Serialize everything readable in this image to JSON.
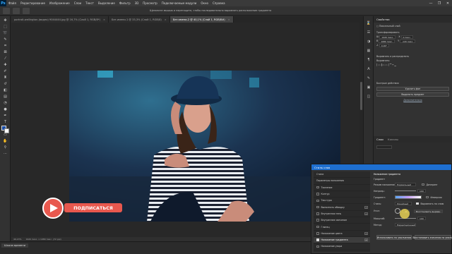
{
  "app": {
    "logo": "Ps"
  },
  "menu": [
    "Файл",
    "Редактирование",
    "Изображение",
    "Слои",
    "Текст",
    "Выделение",
    "Фильтр",
    "3D",
    "Просмотр",
    "Подключаемые модули",
    "Окно",
    "Справка"
  ],
  "window_controls": [
    "—",
    "❐",
    "✕"
  ],
  "options_bar": {
    "hint": "Щелкните мышью и перетащите, чтобы последовательно выровнять расположение градиента"
  },
  "tabs": [
    {
      "label": "portrait-wellington-(видео) 9044444.jpg @ 16,7% (Слой 1, RGB/8*)",
      "active": false
    },
    {
      "label": "Без имени-1 @ 33,3% (Слой 1, RGB/8)",
      "active": false
    },
    {
      "label": "Без имени-2 @ 40,1% (Слой 1, RGB/8#)",
      "active": true
    }
  ],
  "status_bar": {
    "zoom": "40,13%",
    "info": "1920 пикс. x 1080 пикс. (72 ppi)"
  },
  "timeline": {
    "title": "Шкала времени"
  },
  "properties_panel": {
    "title": "Свойства",
    "layer_type": "Пиксельный слой",
    "section_transform": "Трансформировать",
    "w": "1920 пикс.",
    "h": "1080 пикс.",
    "x": "0 пикс.",
    "y": "-120 пикс.",
    "angle": "0,00°",
    "section_align": "Выровнять и распределить",
    "align_label": "Выровнять:",
    "section_quick": "Быстрые действия",
    "btn_remove_bg": "Удалить фон",
    "btn_select_subject": "Выделить предмет",
    "btn_more": "Дополнительно"
  },
  "layers_panel": {
    "tabs": [
      "Слои",
      "Каналы"
    ]
  },
  "dialog": {
    "title": "Стиль слоя",
    "left_items": [
      {
        "label": "Стили",
        "checked": null,
        "plus": false,
        "selected": false
      },
      {
        "label": "Параметры наложения",
        "checked": null,
        "plus": false,
        "selected": false
      },
      {
        "label": "Тиснение",
        "checked": false,
        "plus": false,
        "selected": false
      },
      {
        "label": "Контур",
        "checked": false,
        "plus": false,
        "selected": false
      },
      {
        "label": "Текстура",
        "checked": false,
        "plus": false,
        "selected": false
      },
      {
        "label": "Выполнить обводку",
        "checked": false,
        "plus": true,
        "selected": false
      },
      {
        "label": "Внутренняя тень",
        "checked": false,
        "plus": true,
        "selected": false
      },
      {
        "label": "Внутреннее свечение",
        "checked": false,
        "plus": false,
        "selected": false
      },
      {
        "label": "Глянец",
        "checked": false,
        "plus": false,
        "selected": false
      },
      {
        "label": "Наложение цвета",
        "checked": false,
        "plus": true,
        "selected": false
      },
      {
        "label": "Наложение градиента",
        "checked": true,
        "plus": true,
        "selected": true
      },
      {
        "label": "Наложение узора",
        "checked": false,
        "plus": false,
        "selected": false
      }
    ],
    "section": "Наложение градиента",
    "subsection": "Градиент",
    "blend_mode_label": "Режим наложения:",
    "blend_mode_value": "Нормальный",
    "dither_label": "Дизеринг",
    "opacity_label": "Непрозр.:",
    "opacity_value": "100",
    "reverse_label": "Инверсия",
    "gradient_label": "Градиент:",
    "style_label": "Стиль:",
    "style_value": "Линейный",
    "align_label": "Выровнять по слою",
    "angle_label": "Угол:",
    "angle_value": "90",
    "reset_align": "Восстановить выравн.",
    "scale_label": "Масштаб:",
    "scale_value": "100",
    "method_label": "Метод:",
    "method_value": "Перцепционный",
    "btn_default": "Использовать по умолчанию",
    "btn_reset": "Восстановить значения по умолч."
  },
  "overlay": {
    "subscribe": "ПОДПИСАТЬСЯ"
  },
  "colors": {
    "accent": "#1e6fd0",
    "subscribe": "#e8584e",
    "fg_swatch": "#1c4fa8",
    "bg_swatch": "#ffffff"
  }
}
